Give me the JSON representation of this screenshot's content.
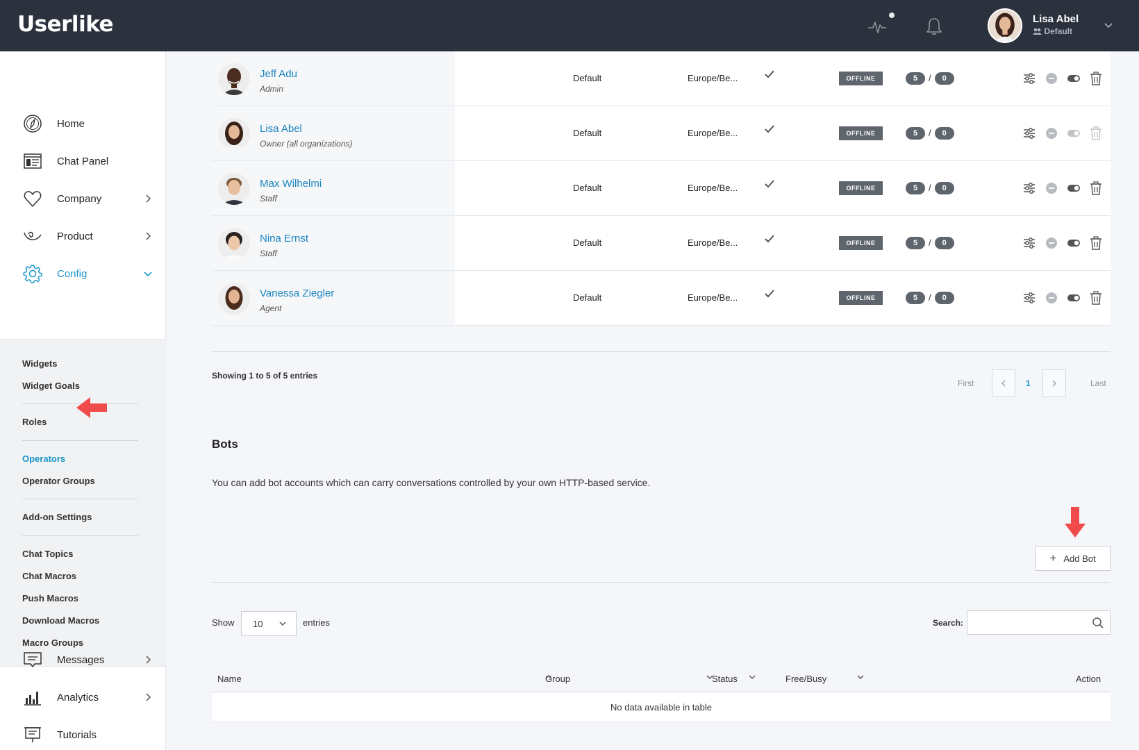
{
  "app": {
    "logo": "Userlike"
  },
  "header": {
    "user_name": "Lisa Abel",
    "user_group": "Default"
  },
  "sidebar": {
    "nav_top": [
      {
        "label": "Home",
        "icon": "compass-icon"
      },
      {
        "label": "Chat Panel",
        "icon": "chat-panel-icon"
      },
      {
        "label": "Company",
        "icon": "heart-icon"
      },
      {
        "label": "Product",
        "icon": "product-icon"
      },
      {
        "label": "Config",
        "icon": "gear-icon"
      }
    ],
    "sub_items": [
      "Widgets",
      "Widget Goals",
      "Roles",
      "Operators",
      "Operator Groups",
      "Add-on Settings",
      "Chat Topics",
      "Chat Macros",
      "Push Macros",
      "Download Macros",
      "Macro Groups"
    ],
    "nav_bottom": [
      {
        "label": "Messages",
        "icon": "messages-icon"
      },
      {
        "label": "Analytics",
        "icon": "bar-chart-icon"
      },
      {
        "label": "Tutorials",
        "icon": "presentation-icon"
      }
    ],
    "active_sub": "Operators",
    "active_nav": "Config"
  },
  "operators": [
    {
      "name": "Jeff Adu",
      "role": "Admin",
      "group": "Default",
      "timezone": "Europe/Be...",
      "status": "OFFLINE",
      "cap_max": "5",
      "cap_current": "0"
    },
    {
      "name": "Lisa Abel",
      "role": "Owner (all organizations)",
      "group": "Default",
      "timezone": "Europe/Be...",
      "status": "OFFLINE",
      "cap_max": "5",
      "cap_current": "0"
    },
    {
      "name": "Max Wilhelmi",
      "role": "Staff",
      "group": "Default",
      "timezone": "Europe/Be...",
      "status": "OFFLINE",
      "cap_max": "5",
      "cap_current": "0"
    },
    {
      "name": "Nina Ernst",
      "role": "Staff",
      "group": "Default",
      "timezone": "Europe/Be...",
      "status": "OFFLINE",
      "cap_max": "5",
      "cap_current": "0"
    },
    {
      "name": "Vanessa Ziegler",
      "role": "Agent",
      "group": "Default",
      "timezone": "Europe/Be...",
      "status": "OFFLINE",
      "cap_max": "5",
      "cap_current": "0"
    }
  ],
  "pagination": {
    "showing": "Showing 1 to 5 of 5 entries",
    "first": "First",
    "current": "1",
    "last": "Last"
  },
  "bots": {
    "title": "Bots",
    "description": "You can add bot accounts which can carry conversations controlled by your own HTTP-based service.",
    "add_label": "Add Bot",
    "show_label": "Show",
    "show_value": "10",
    "entries_label": "entries",
    "search_label": "Search:",
    "search_value": "",
    "columns": [
      "Name",
      "Group",
      "Status",
      "Free/Busy",
      "Action"
    ],
    "empty": "No data available in table"
  },
  "colors": {
    "accent": "#1a94c8",
    "header_bg": "#2b323d",
    "annotation_arrow": "#f04a4a",
    "status_badge": "#5f656c"
  }
}
